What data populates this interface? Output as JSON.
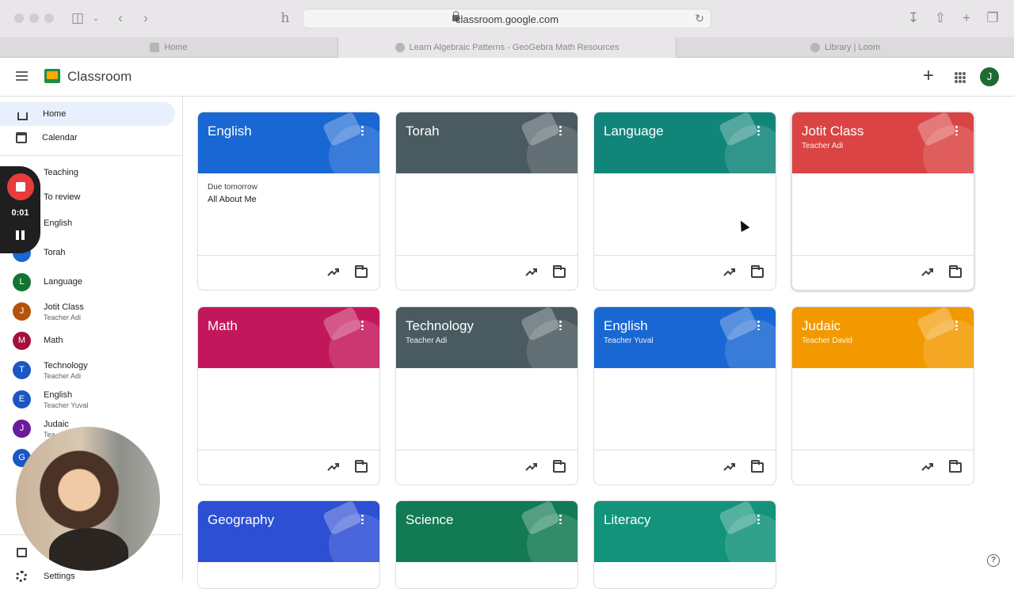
{
  "browser": {
    "url": "classroom.google.com",
    "tabs": [
      {
        "label": "Home"
      },
      {
        "label": "Learn Algebraic Patterns - GeoGebra Math Resources"
      },
      {
        "label": "Library | Loom"
      }
    ]
  },
  "header": {
    "title": "Classroom",
    "account_initial": "J"
  },
  "sidebar": {
    "home": "Home",
    "calendar": "Calendar",
    "teaching": "Teaching",
    "to_review": "To review",
    "classes": [
      {
        "initial": "",
        "name": "English",
        "sub": "",
        "color": "#1967d2"
      },
      {
        "initial": "",
        "name": "Torah",
        "sub": "",
        "color": "#1967d2"
      },
      {
        "initial": "L",
        "name": "Language",
        "sub": "",
        "color": "#137333"
      },
      {
        "initial": "J",
        "name": "Jotit Class",
        "sub": "Teacher Adi",
        "color": "#b45309"
      },
      {
        "initial": "M",
        "name": "Math",
        "sub": "",
        "color": "#a50e3c"
      },
      {
        "initial": "T",
        "name": "Technology",
        "sub": "Teacher Adi",
        "color": "#1a56c4"
      },
      {
        "initial": "E",
        "name": "English",
        "sub": "Teacher Yuval",
        "color": "#1a56c4"
      },
      {
        "initial": "J",
        "name": "Judaic",
        "sub": "Tea",
        "color": "#6a1b9a"
      },
      {
        "initial": "G",
        "name": "",
        "sub": "",
        "color": "#1a56c4"
      }
    ],
    "settings": "Settings"
  },
  "loom": {
    "time": "0:01"
  },
  "cards": [
    {
      "title": "English",
      "sub": "",
      "color": "#1967d2",
      "due": "Due tomorrow",
      "assignment": "All About Me"
    },
    {
      "title": "Torah",
      "sub": "",
      "color": "#4a5a61",
      "due": "",
      "assignment": ""
    },
    {
      "title": "Language",
      "sub": "",
      "color": "#12857a",
      "due": "",
      "assignment": ""
    },
    {
      "title": "Jotit Class",
      "sub": "Teacher Adi",
      "color": "#db4444",
      "due": "",
      "assignment": ""
    },
    {
      "title": "Math",
      "sub": "",
      "color": "#c2185b",
      "due": "",
      "assignment": ""
    },
    {
      "title": "Technology",
      "sub": "Teacher Adi",
      "color": "#4a5a61",
      "due": "",
      "assignment": ""
    },
    {
      "title": "English",
      "sub": "Teacher Yuval",
      "color": "#1967d2",
      "due": "",
      "assignment": ""
    },
    {
      "title": "Judaic",
      "sub": "Teacher David",
      "color": "#f29900",
      "due": "",
      "assignment": ""
    },
    {
      "title": "Geography",
      "sub": "",
      "color": "#2d4fd4",
      "due": "",
      "assignment": ""
    },
    {
      "title": "Science",
      "sub": "",
      "color": "#127a54",
      "due": "",
      "assignment": ""
    },
    {
      "title": "Literacy",
      "sub": "",
      "color": "#12937a",
      "due": "",
      "assignment": ""
    }
  ],
  "colors": {
    "accent": "#1a73e8",
    "active_nav_bg": "#e8f0fe"
  },
  "icons": [
    "hamburger-icon",
    "plus-icon",
    "apps-icon",
    "home-icon",
    "calendar-icon",
    "trend-icon",
    "folder-icon",
    "kebab-icon",
    "help-icon",
    "settings-icon",
    "archive-icon"
  ]
}
